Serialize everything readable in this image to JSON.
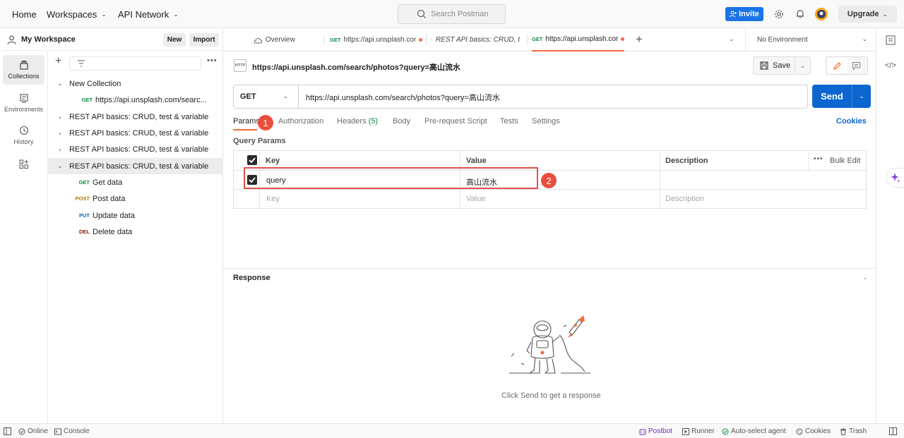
{
  "topbar": {
    "nav": [
      "Home",
      "Workspaces",
      "API Network"
    ],
    "search_placeholder": "Search Postman",
    "invite_label": "Invite",
    "upgrade_label": "Upgrade",
    "accent_color": "#1a73e8"
  },
  "sidebar": {
    "workspace_title": "My Workspace",
    "new_label": "New",
    "import_label": "Import",
    "rail": [
      {
        "label": "Collections",
        "icon": "collections-icon",
        "active": true
      },
      {
        "label": "Environments",
        "icon": "environments-icon"
      },
      {
        "label": "History",
        "icon": "history-icon"
      },
      {
        "label": "",
        "icon": "add-apps-icon"
      }
    ],
    "tree": [
      {
        "label": "New Collection",
        "arrow": "⌄"
      },
      {
        "label": "https://api.unsplash.com/searc...",
        "method": "GET"
      },
      {
        "label": "REST API basics: CRUD, test & variable",
        "arrow": "›"
      },
      {
        "label": "REST API basics: CRUD, test & variable",
        "arrow": "›"
      },
      {
        "label": "REST API basics: CRUD, test & variable",
        "arrow": "›"
      },
      {
        "label": "REST API basics: CRUD, test & variable",
        "arrow": "⌄",
        "selected": true
      },
      {
        "label": "Get data",
        "method": "GET"
      },
      {
        "label": "Post data",
        "method": "POST"
      },
      {
        "label": "Update data",
        "method": "PUT"
      },
      {
        "label": "Delete data",
        "method": "DEL"
      }
    ]
  },
  "tabs": [
    {
      "label": "Overview"
    },
    {
      "method": "GET",
      "label": "https://api.unsplash.cor"
    },
    {
      "label": "REST API basics: CRUD, t"
    },
    {
      "method": "GET",
      "label": "https://api.unsplash.cor"
    }
  ],
  "environment": "No Environment",
  "request": {
    "title": "https://api.unsplash.com/search/photos?query=高山流水",
    "http_badge": "HTTP",
    "save_label": "Save",
    "method": "GET",
    "url": "https://api.unsplash.com/search/photos?query=高山流水",
    "send_label": "Send",
    "tabs": [
      "Params",
      "Authorization",
      "Headers",
      "Body",
      "Pre-request Script",
      "Tests",
      "Settings"
    ],
    "headers_count": "(5)",
    "cookies_label": "Cookies",
    "query_params_label": "Query Params",
    "columns": [
      "Key",
      "Value",
      "Description"
    ],
    "bulk_edit_label": "Bulk Edit",
    "param_rows": [
      {
        "key": "query",
        "value": "高山流水",
        "checked": true
      }
    ],
    "placeholders": {
      "key": "Key",
      "value": "Value",
      "description": "Description"
    }
  },
  "annotations": [
    "1",
    "2"
  ],
  "response": {
    "title": "Response",
    "hint": "Click Send to get a response"
  },
  "statusbar": {
    "online": "Online",
    "console": "Console",
    "postbot": "Postbot",
    "runner": "Runner",
    "agent": "Auto-select agent",
    "cookies": "Cookies",
    "trash": "Trash"
  }
}
